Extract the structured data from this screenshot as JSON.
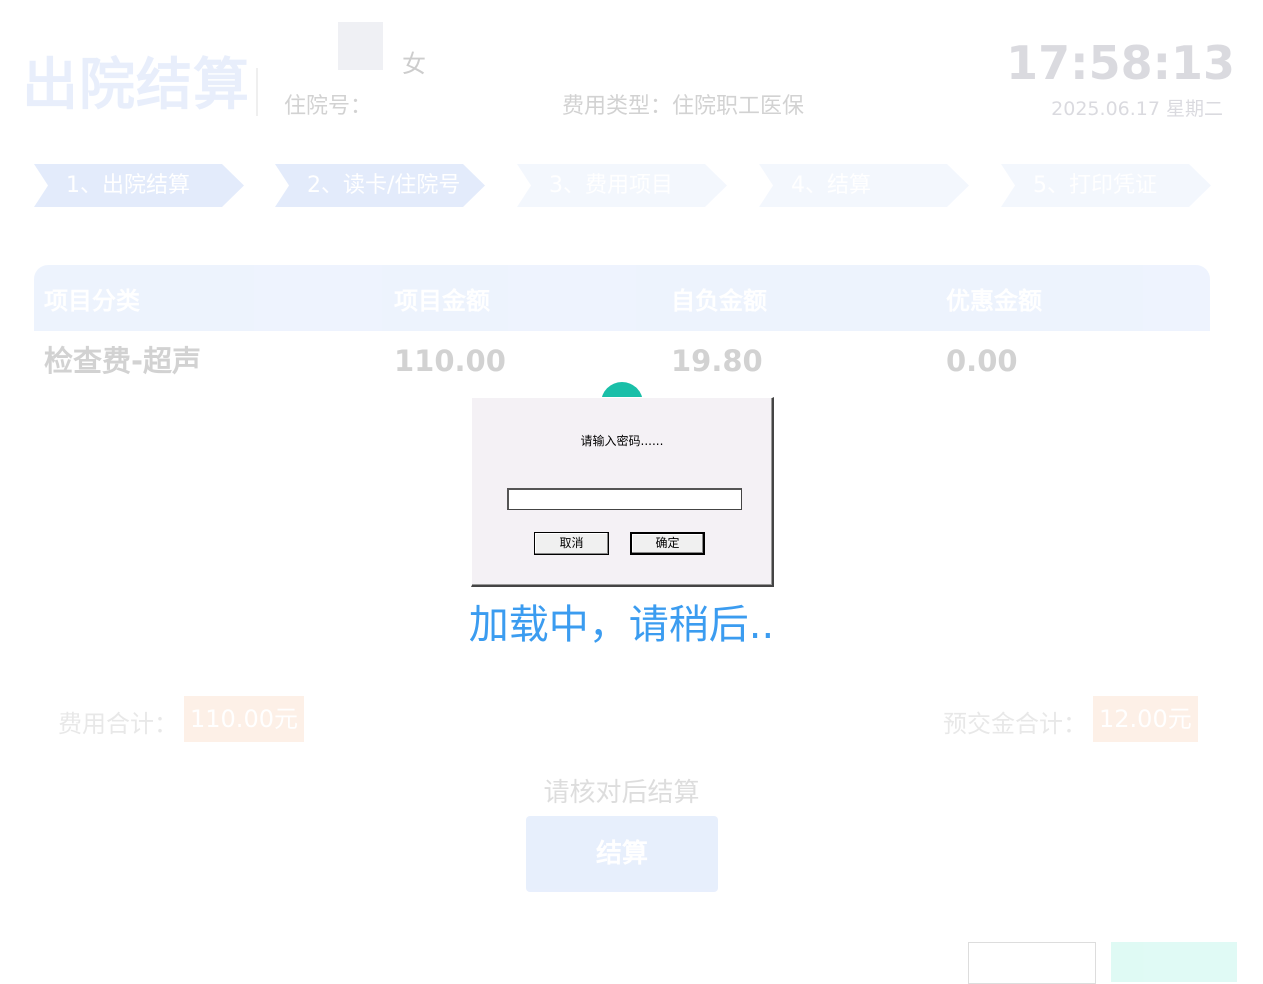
{
  "header": {
    "title": "出院结算",
    "patient_name": "",
    "gender": "女",
    "inpatient_no_label": "住院号：",
    "fee_type": "费用类型：住院职工医保",
    "time": "17:58:13",
    "date": "2025.06.17 星期二"
  },
  "steps": [
    {
      "label": "1、出院结算",
      "active": true
    },
    {
      "label": "2、读卡/住院号",
      "active": true
    },
    {
      "label": "3、费用项目",
      "active": false
    },
    {
      "label": "4、结算",
      "active": false
    },
    {
      "label": "5、打印凭证",
      "active": false
    }
  ],
  "table": {
    "columns": [
      "项目分类",
      "项目金额",
      "自负金额",
      "优惠金额"
    ],
    "rows": [
      [
        "检查费-超声",
        "110.00",
        "19.80",
        "0.00"
      ]
    ]
  },
  "summary": {
    "total_label": "费用合计：",
    "total_value": "110.00元",
    "prepaid_label": "预交金合计：",
    "prepaid_value": "12.00元"
  },
  "hint": "请核对后结算",
  "settle_button": "结算",
  "dialog": {
    "prompt": "请输入密码......",
    "input_value": "",
    "cancel_label": "取消",
    "ok_label": "确定"
  },
  "loading_text": "加载中，请稍后..",
  "colors": {
    "accent_blue": "#3b9cf0",
    "step_active": "#abc4f5",
    "teal": "#19bfa8",
    "amount_bg": "#fbd2b6"
  }
}
